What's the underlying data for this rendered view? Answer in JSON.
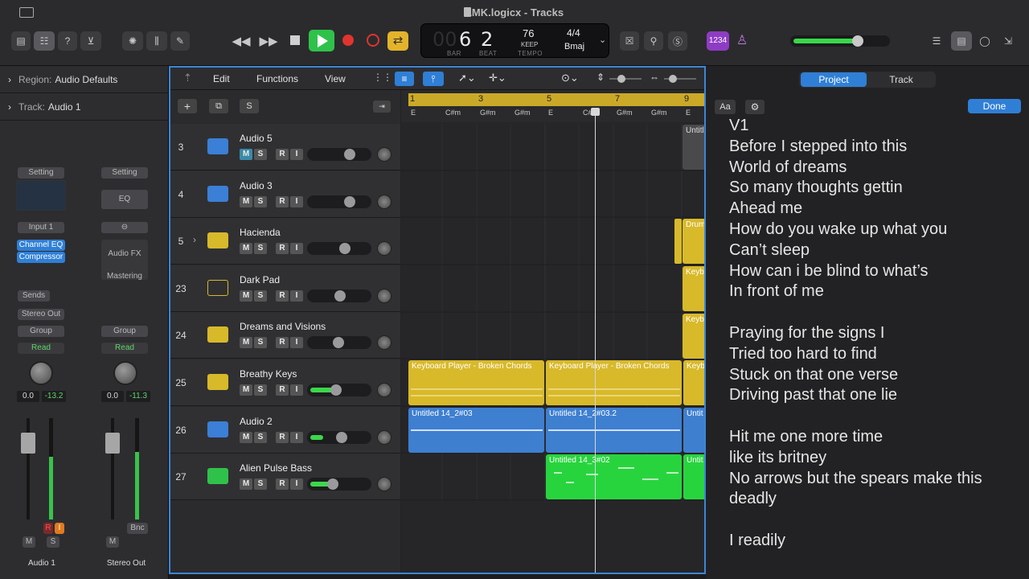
{
  "window": {
    "title": "LMK.logicx - Tracks"
  },
  "transport": {
    "bar_ghost": "00",
    "bar": "6",
    "beat": "2",
    "bar_label": "BAR",
    "beat_label": "BEAT",
    "tempo": "76",
    "tempo_mode": "KEEP",
    "tempo_label": "TEMPO",
    "time_signature": "4/4",
    "key": "Bmaj",
    "count_in": "1234"
  },
  "inspector": {
    "region_label": "Region:",
    "region_value": "Audio Defaults",
    "track_label": "Track:",
    "track_value": "Audio 1",
    "strip1": {
      "setting": "Setting",
      "input": "Input 1",
      "plugin1": "Channel EQ",
      "plugin2": "Compressor",
      "sends": "Sends",
      "output": "Stereo Out",
      "group": "Group",
      "automation": "Read",
      "vol": "0.0",
      "peak": "-13.2",
      "r_btn": "R",
      "i_btn": "I",
      "m_btn": "M",
      "s_btn": "S",
      "name": "Audio 1"
    },
    "strip2": {
      "setting": "Setting",
      "eq": "EQ",
      "fx": "Audio FX",
      "mastering": "Mastering",
      "group": "Group",
      "automation": "Read",
      "vol": "0.0",
      "peak": "-11.3",
      "bnc": "Bnc",
      "m_btn": "M",
      "name": "Stereo Out"
    }
  },
  "tracks_menu": {
    "edit": "Edit",
    "functions": "Functions",
    "view": "View"
  },
  "track_header_buttons": {
    "add": "+",
    "s": "S"
  },
  "ruler": {
    "bars": [
      "1",
      "3",
      "5",
      "7",
      "9"
    ],
    "chords": [
      "E",
      "C#m",
      "G#m",
      "G#m",
      "E",
      "C#m",
      "G#m",
      "G#m",
      "E"
    ]
  },
  "track_buttons": {
    "m": "M",
    "s": "S",
    "r": "R",
    "i": "I"
  },
  "tracks": [
    {
      "num": "3",
      "name": "Audio 5",
      "type": "audio",
      "fader": 0.7
    },
    {
      "num": "4",
      "name": "Audio 3",
      "type": "audio",
      "fader": 0.7
    },
    {
      "num": "5",
      "name": "Hacienda",
      "type": "drummer",
      "fader": 0.6
    },
    {
      "num": "23",
      "name": "Dark Pad",
      "type": "synth",
      "fader": 0.52
    },
    {
      "num": "24",
      "name": "Dreams and Visions",
      "type": "keys",
      "fader": 0.48
    },
    {
      "num": "25",
      "name": "Breathy Keys",
      "type": "keys",
      "fader": 0.44
    },
    {
      "num": "26",
      "name": "Audio 2",
      "type": "audio",
      "fader": 0.55
    },
    {
      "num": "27",
      "name": "Alien Pulse Bass",
      "type": "synth-green",
      "fader": 0.38
    }
  ],
  "regions": {
    "r3": "Untitl",
    "r5": "Drum",
    "r23": "Keyb",
    "r24": "Keyb",
    "r25a": "Keyboard Player - Broken Chords",
    "r25b": "Keyboard Player - Broken Chords",
    "r25c": "Keyb",
    "r26a": "Untitled 14_2#03",
    "r26b": "Untitled 14_2#03.2",
    "r26c": "Untit",
    "r27a": "Untitled 14_3#02",
    "r27b": "Untit"
  },
  "notes_panel": {
    "tab_project": "Project",
    "tab_track": "Track",
    "font_btn": "Aa",
    "done": "Done",
    "lyrics": [
      "V1",
      "Before I stepped into this",
      "World of dreams",
      "So many thoughts gettin",
      "Ahead me",
      "How do you wake up what you",
      "Can’t sleep",
      "How can i be blind to what’s",
      "In front of me",
      "",
      "Praying for the signs I",
      "Tried too hard to find",
      "Stuck on that one verse",
      "Driving past that one lie",
      "",
      "Hit me one more time",
      "like its britney",
      "No arrows but the spears make this",
      "deadly",
      "",
      "I readily"
    ]
  },
  "colors": {
    "accent": "#2f7fd6",
    "play": "#2fc24a",
    "record": "#e0342f",
    "cycle": "#e3b32b",
    "region_yellow": "#d8b92a",
    "region_blue": "#3e7fd0",
    "region_green": "#28d43e"
  }
}
